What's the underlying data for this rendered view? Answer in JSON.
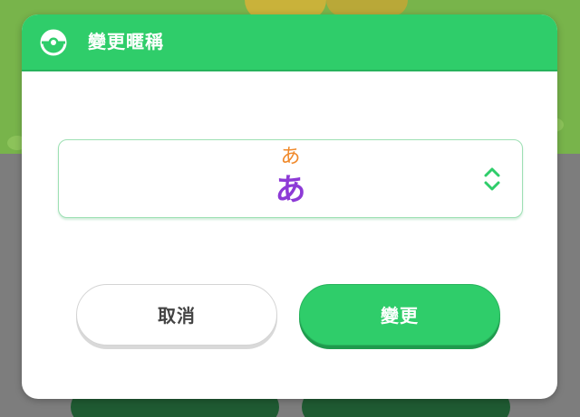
{
  "dialog": {
    "title": "變更暱稱",
    "header_icon": "pokeball-icon"
  },
  "nickname_field": {
    "kana_hint": "あ",
    "kana_value": "あ",
    "stepper_icon": "chevron-up-down-icon"
  },
  "buttons": {
    "cancel_label": "取消",
    "confirm_label": "變更"
  },
  "colors": {
    "accent": "#2fcd6a",
    "hint_orange": "#f0892a",
    "kana_purple": "#8d3ad6"
  }
}
